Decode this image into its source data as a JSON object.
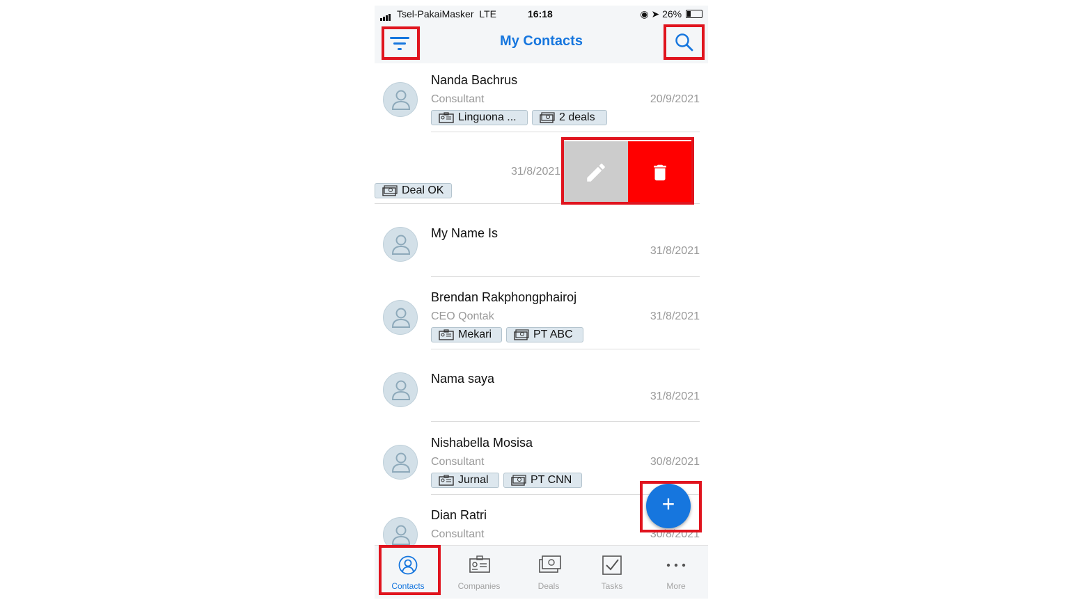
{
  "status_bar": {
    "carrier": "Tsel-PakaiMasker",
    "network": "LTE",
    "time": "16:18",
    "battery": "26%"
  },
  "header": {
    "title": "My Contacts",
    "filter_icon": "filter-icon",
    "search_icon": "search-icon"
  },
  "contacts": [
    {
      "name": "Nanda Bachrus",
      "role": "Consultant",
      "date": "20/9/2021",
      "company_tag": "Linguona ...",
      "deal_tag": "2 deals"
    },
    {
      "date": "31/8/2021",
      "deal_tag": "Deal OK"
    },
    {
      "name": "My Name Is",
      "date": "31/8/2021"
    },
    {
      "name": "Brendan Rakphongphairoj",
      "role": "CEO Qontak",
      "date": "31/8/2021",
      "company_tag": "Mekari",
      "deal_tag": "PT ABC"
    },
    {
      "name": "Nama saya",
      "date": "31/8/2021"
    },
    {
      "name": "Nishabella Mosisa",
      "role": "Consultant",
      "date": "30/8/2021",
      "company_tag": "Jurnal",
      "deal_tag": "PT CNN"
    },
    {
      "name": "Dian Ratri",
      "role": "Consultant",
      "date": "30/8/2021"
    }
  ],
  "swipe_actions": {
    "edit_icon": "pencil-icon",
    "delete_icon": "trash-icon",
    "delete_color": "#ff0000",
    "edit_color": "#cccccc"
  },
  "fab": {
    "label": "+"
  },
  "tabs": [
    {
      "label": "Contacts",
      "icon": "person-circle-icon",
      "active": true
    },
    {
      "label": "Companies",
      "icon": "id-card-icon"
    },
    {
      "label": "Deals",
      "icon": "money-icon"
    },
    {
      "label": "Tasks",
      "icon": "checkbox-icon"
    },
    {
      "label": "More",
      "icon": "more-dots-icon"
    }
  ],
  "colors": {
    "accent": "#1676de",
    "highlight": "#e0141e"
  }
}
